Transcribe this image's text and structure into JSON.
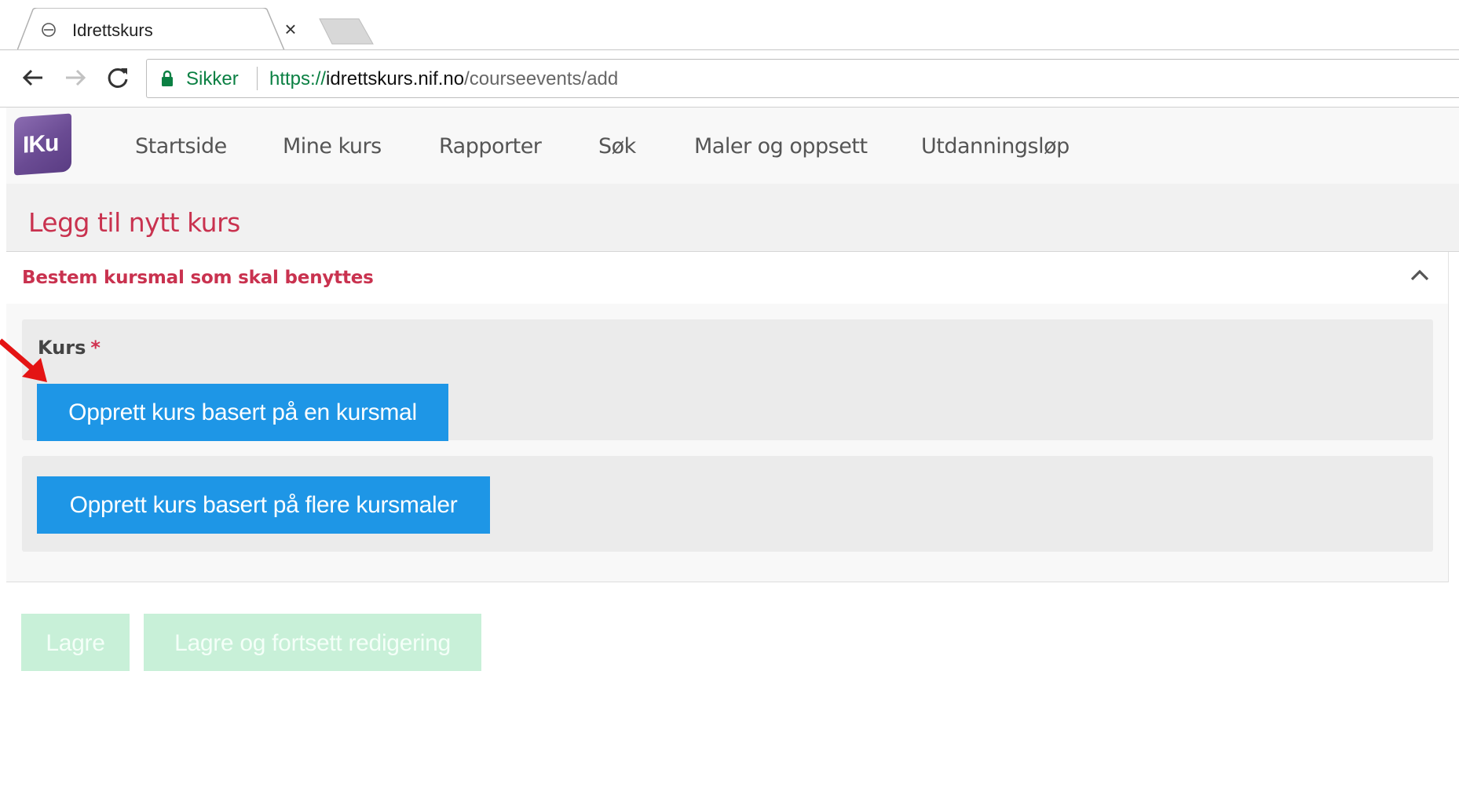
{
  "browser": {
    "tab_title": "Idrettskurs",
    "tab_close": "×",
    "secure_label": "Sikker",
    "url_scheme": "https://",
    "url_host": "idrettskurs.nif.no",
    "url_path": "/courseevents/add"
  },
  "app": {
    "logo_text": "IKu",
    "nav": [
      "Startside",
      "Mine kurs",
      "Rapporter",
      "Søk",
      "Maler og oppsett",
      "Utdanningsløp"
    ]
  },
  "page": {
    "title": "Legg til nytt kurs",
    "section_title": "Bestem kursmal som skal benyttes",
    "field_label": "Kurs",
    "required_mark": "*",
    "btn_single_template": "Opprett kurs basert på en kursmal",
    "btn_multi_template": "Opprett kurs basert på flere kursmaler",
    "btn_save": "Lagre",
    "btn_save_continue": "Lagre og fortsett redigering"
  },
  "colors": {
    "accent_red": "#c9324f",
    "primary_blue": "#1e96e6",
    "disabled_green": "#c8f0d8",
    "logo_purple": "#6a4b93"
  }
}
